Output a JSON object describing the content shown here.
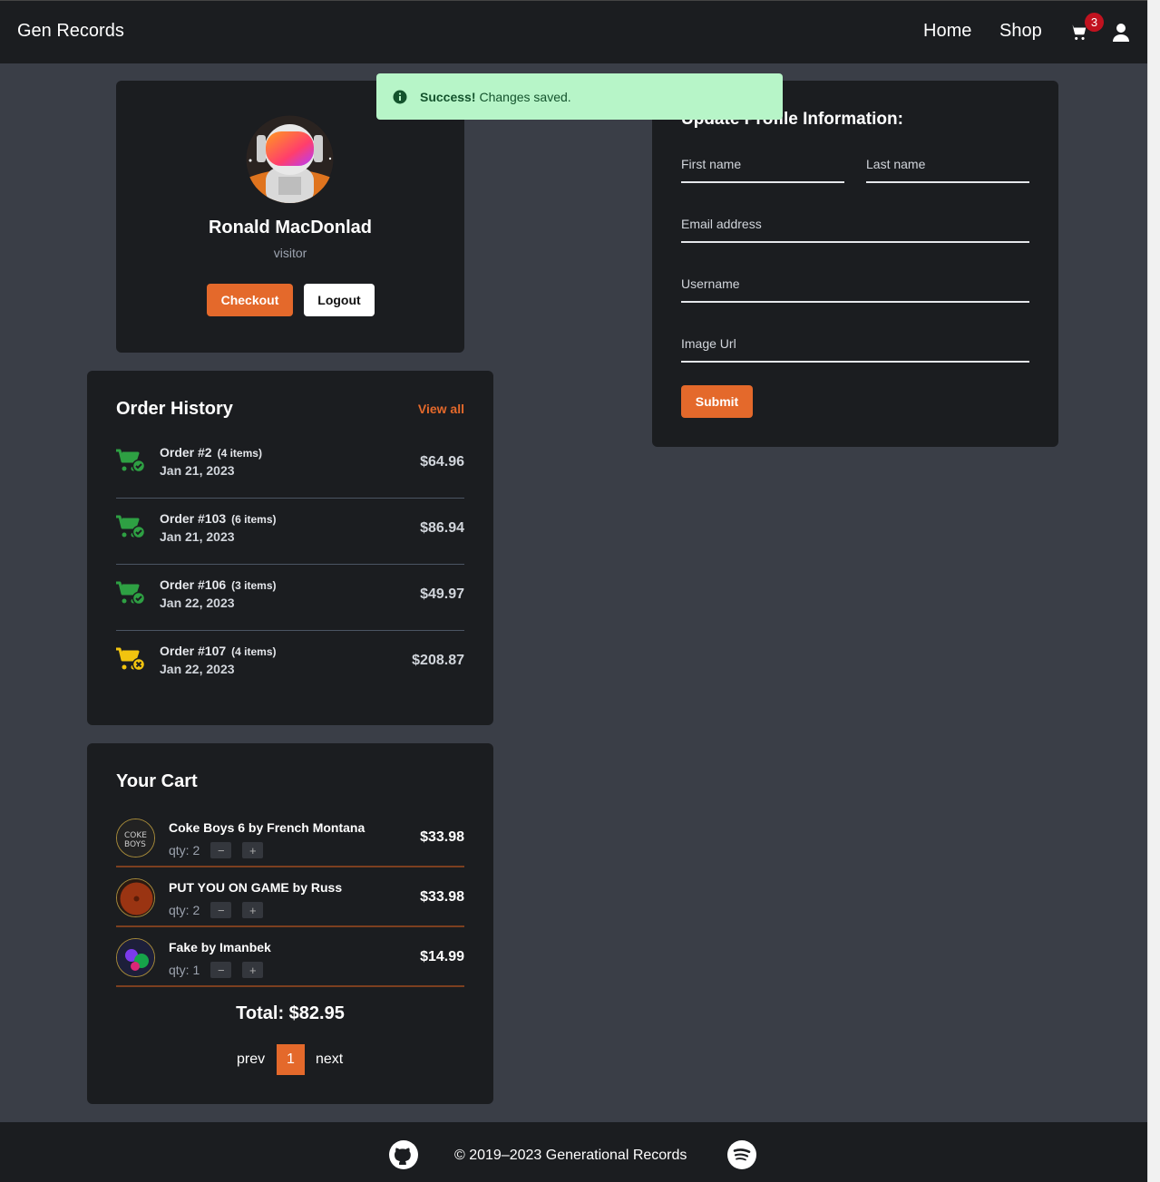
{
  "nav": {
    "brand": "Gen Records",
    "links": [
      "Home",
      "Shop"
    ],
    "cart_count": "3",
    "cart_icon": "shopping-cart-icon",
    "user_icon": "user-icon"
  },
  "alert": {
    "strong": "Success!",
    "message": "Changes saved.",
    "icon": "info-icon"
  },
  "profile": {
    "name": "Ronald MacDonlad",
    "role": "visitor",
    "checkout_label": "Checkout",
    "logout_label": "Logout"
  },
  "update_form": {
    "title": "Update Profile Information:",
    "first_name_label": "First name",
    "last_name_label": "Last name",
    "email_label": "Email address",
    "username_label": "Username",
    "image_url_label": "Image Url",
    "submit_label": "Submit"
  },
  "orders": {
    "title": "Order History",
    "view_all": "View all",
    "items": [
      {
        "name": "Order #2",
        "count": "(4 items)",
        "date": "Jan 21, 2023",
        "total": "$64.96",
        "status": "complete"
      },
      {
        "name": "Order #103",
        "count": "(6 items)",
        "date": "Jan 21, 2023",
        "total": "$86.94",
        "status": "complete"
      },
      {
        "name": "Order #106",
        "count": "(3 items)",
        "date": "Jan 22, 2023",
        "total": "$49.97",
        "status": "complete"
      },
      {
        "name": "Order #107",
        "count": "(4 items)",
        "date": "Jan 22, 2023",
        "total": "$208.87",
        "status": "cancelled"
      }
    ]
  },
  "cart": {
    "title": "Your Cart",
    "qty_prefix": "qty:",
    "items": [
      {
        "name": "Coke Boys 6 by French Montana",
        "qty": "2",
        "price": "$33.98"
      },
      {
        "name": "PUT YOU ON GAME by Russ",
        "qty": "2",
        "price": "$33.98"
      },
      {
        "name": "Fake by Imanbek",
        "qty": "1",
        "price": "$14.99"
      }
    ],
    "minus": "−",
    "plus": "+",
    "total": "Total: $82.95",
    "pager": {
      "prev": "prev",
      "page": "1",
      "next": "next"
    }
  },
  "footer": {
    "text": "© 2019–2023 Generational Records",
    "left_icon": "github-icon",
    "right_icon": "spotify-icon"
  },
  "colors": {
    "accent": "#e4692b",
    "card": "#1b1d20",
    "background": "#3a3e47",
    "success_bg": "#b7f5c8",
    "complete_icon": "#2ea043",
    "cancelled_icon": "#f2c40f",
    "badge": "#c1121f"
  }
}
